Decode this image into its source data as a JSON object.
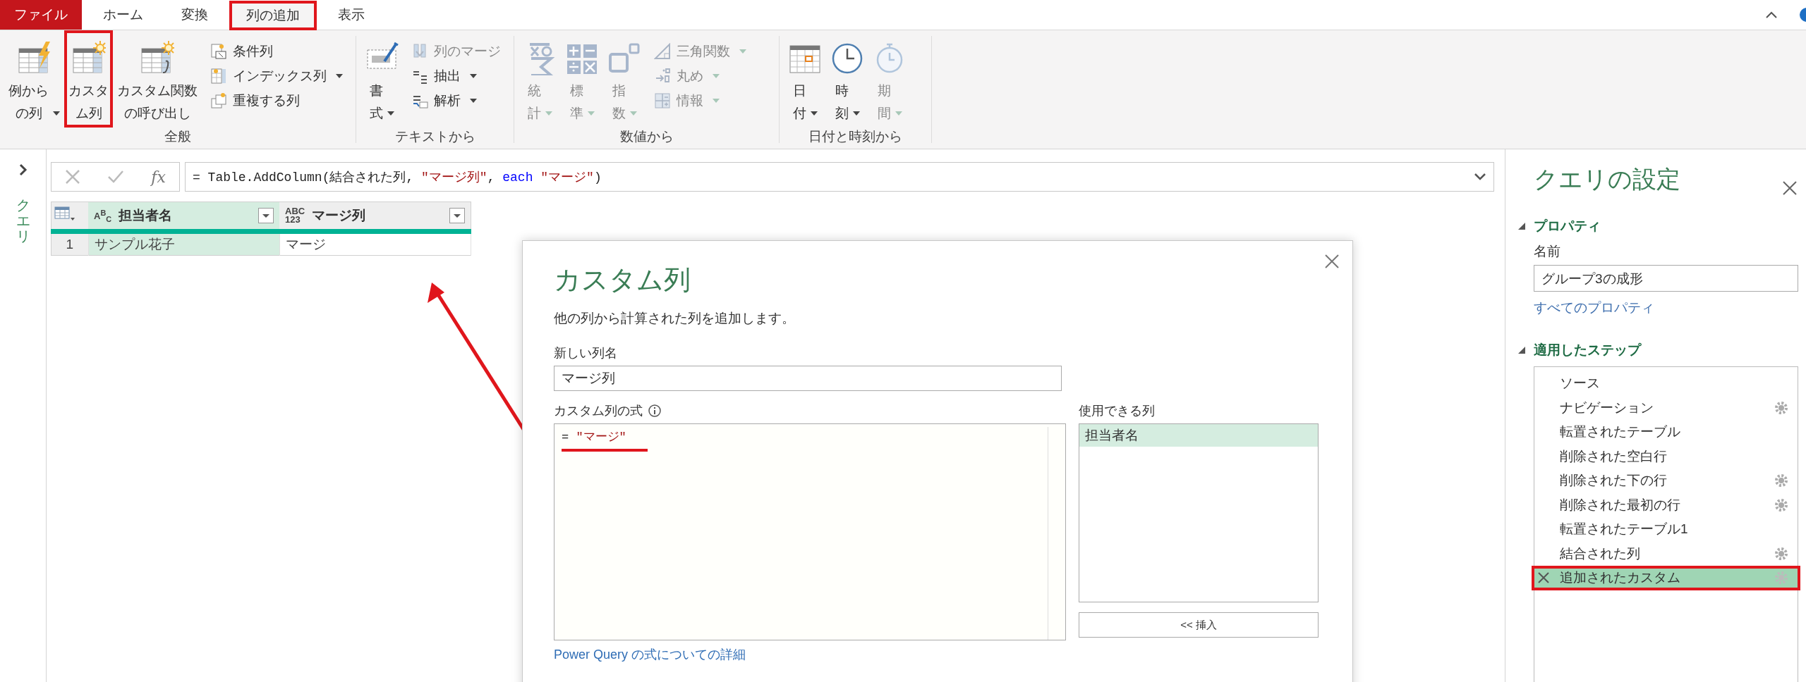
{
  "tabs": [
    {
      "label": "ファイル",
      "kind": "file",
      "selected": false,
      "highlighted": false
    },
    {
      "label": "ホーム",
      "kind": "tab",
      "selected": false,
      "highlighted": false
    },
    {
      "label": "変換",
      "kind": "tab",
      "selected": false,
      "highlighted": false
    },
    {
      "label": "列の追加",
      "kind": "tab",
      "selected": true,
      "highlighted": true
    },
    {
      "label": "表示",
      "kind": "tab",
      "selected": false,
      "highlighted": false
    }
  ],
  "ribbon": {
    "groups": [
      {
        "title": "全般",
        "items": [
          {
            "kind": "large",
            "label": "例からの列",
            "dropdown": true,
            "disabled": false,
            "highlighted": false
          },
          {
            "kind": "large",
            "label": "カスタム列",
            "dropdown": false,
            "disabled": false,
            "highlighted": true
          },
          {
            "kind": "large",
            "label": "カスタム関数の呼び出し",
            "dropdown": false,
            "disabled": false,
            "highlighted": false
          },
          {
            "kind": "small",
            "label": "条件列",
            "dropdown": false,
            "disabled": false,
            "highlighted": false
          },
          {
            "kind": "small",
            "label": "インデックス列",
            "dropdown": true,
            "disabled": false,
            "highlighted": false
          },
          {
            "kind": "small",
            "label": "重複する列",
            "dropdown": false,
            "disabled": false,
            "highlighted": false
          }
        ]
      },
      {
        "title": "テキストから",
        "items": [
          {
            "kind": "large",
            "label": "書式",
            "dropdown": true,
            "disabled": false,
            "highlighted": false
          },
          {
            "kind": "small",
            "label": "列のマージ",
            "dropdown": false,
            "disabled": true,
            "highlighted": false
          },
          {
            "kind": "small",
            "label": "抽出",
            "dropdown": true,
            "disabled": false,
            "highlighted": false
          },
          {
            "kind": "small",
            "label": "解析",
            "dropdown": true,
            "disabled": false,
            "highlighted": false
          }
        ]
      },
      {
        "title": "数値から",
        "items": [
          {
            "kind": "large",
            "label": "統計",
            "dropdown": true,
            "disabled": true,
            "highlighted": false
          },
          {
            "kind": "large",
            "label": "標準",
            "dropdown": true,
            "disabled": true,
            "highlighted": false
          },
          {
            "kind": "large",
            "label": "指数",
            "dropdown": true,
            "disabled": true,
            "highlighted": false
          },
          {
            "kind": "small",
            "label": "三角関数",
            "dropdown": true,
            "disabled": true,
            "highlighted": false
          },
          {
            "kind": "small",
            "label": "丸め",
            "dropdown": true,
            "disabled": true,
            "highlighted": false
          },
          {
            "kind": "small",
            "label": "情報",
            "dropdown": true,
            "disabled": true,
            "highlighted": false
          }
        ]
      },
      {
        "title": "日付と時刻から",
        "items": [
          {
            "kind": "large",
            "label": "日付",
            "dropdown": true,
            "disabled": false,
            "highlighted": false
          },
          {
            "kind": "large",
            "label": "時刻",
            "dropdown": true,
            "disabled": false,
            "highlighted": false
          },
          {
            "kind": "large",
            "label": "期間",
            "dropdown": true,
            "disabled": true,
            "highlighted": false
          }
        ]
      }
    ]
  },
  "query_pane": {
    "label": "クエリ"
  },
  "formula_bar": {
    "fx": "fx",
    "tokens": [
      {
        "kind": "plain",
        "text": "= Table.AddColumn(結合された列, "
      },
      {
        "kind": "string",
        "text": "\"マージ列\""
      },
      {
        "kind": "plain",
        "text": ", "
      },
      {
        "kind": "keyword",
        "text": "each "
      },
      {
        "kind": "string",
        "text": "\"マージ\""
      },
      {
        "kind": "plain",
        "text": ")"
      }
    ]
  },
  "table": {
    "columns": [
      {
        "type": "A$^{B}$$_{C}$",
        "name": "担当者名",
        "selected": true
      },
      {
        "type": "ABC\n123",
        "name": "マージ列",
        "selected": false
      }
    ],
    "rows": [
      {
        "number": "1",
        "cells": [
          "サンプル花子",
          "マージ"
        ]
      }
    ]
  },
  "dialog": {
    "title": "カスタム列",
    "description": "他の列から計算された列を追加します。",
    "name_label": "新しい列名",
    "name_value": "マージ列",
    "expression_label": "カスタム列の式",
    "expression": [
      {
        "kind": "plain",
        "text": "= "
      },
      {
        "kind": "string",
        "text": "\"マージ\""
      }
    ],
    "expression_underlined": true,
    "available_label": "使用できる列",
    "available_columns": [
      {
        "label": "担当者名",
        "selected": true
      }
    ],
    "insert_button": "<< 挿入",
    "help_link": "Power Query の式についての詳細"
  },
  "settings": {
    "title": "クエリの設定",
    "sections": [
      {
        "title": "プロパティ",
        "expanded": true
      },
      {
        "title": "適用したステップ",
        "expanded": true
      }
    ],
    "name_label": "名前",
    "name_value": "グループ3の成形",
    "all_properties_link": "すべてのプロパティ",
    "steps": [
      {
        "label": "ソース",
        "has_settings": false,
        "selected": false,
        "highlighted": false
      },
      {
        "label": "ナビゲーション",
        "has_settings": true,
        "selected": false,
        "highlighted": false
      },
      {
        "label": "転置されたテーブル",
        "has_settings": false,
        "selected": false,
        "highlighted": false
      },
      {
        "label": "削除された空白行",
        "has_settings": false,
        "selected": false,
        "highlighted": false
      },
      {
        "label": "削除された下の行",
        "has_settings": true,
        "selected": false,
        "highlighted": false
      },
      {
        "label": "削除された最初の行",
        "has_settings": true,
        "selected": false,
        "highlighted": false
      },
      {
        "label": "転置されたテーブル1",
        "has_settings": false,
        "selected": false,
        "highlighted": false
      },
      {
        "label": "結合された列",
        "has_settings": true,
        "selected": false,
        "highlighted": false
      },
      {
        "label": "追加されたカスタム",
        "has_settings": true,
        "selected": true,
        "highlighted": true
      }
    ]
  }
}
